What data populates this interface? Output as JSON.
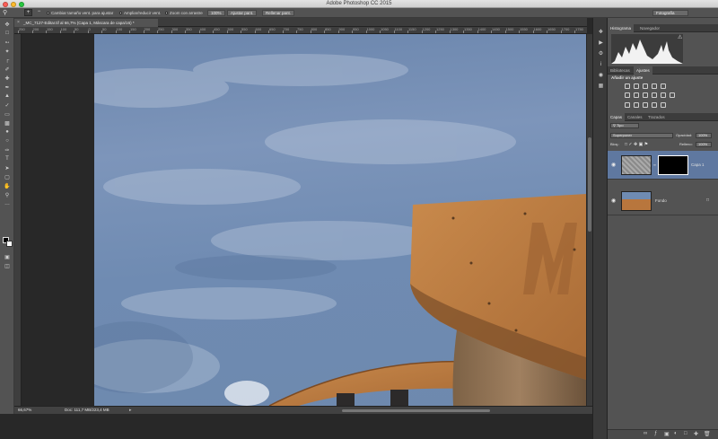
{
  "window": {
    "title": "Adobe Photoshop CC 2015"
  },
  "options_bar": {
    "resize_windows": "Cambiar tamaño vent. para ajustar",
    "zoom_all": "Ampliar/reducir vent.",
    "scrubby_zoom": "Zoom con arrastre",
    "zoom_level": "100%",
    "fit_screen": "Ajustar pant.",
    "fill_screen": "Rellenar pant.",
    "workspace": "Fotografía"
  },
  "document": {
    "tab_title": "_MC_7127-Editar.tif al 66,7% (Capa 1, Máscara de capa/16) *"
  },
  "ruler": {
    "ticks": [
      "250",
      "200",
      "150",
      "100",
      "50",
      "0",
      "50",
      "100",
      "150",
      "200",
      "250",
      "300",
      "350",
      "400",
      "450",
      "500",
      "550",
      "600",
      "650",
      "700",
      "750",
      "800",
      "850",
      "900",
      "950",
      "1000",
      "1050",
      "1100",
      "1150",
      "1200",
      "1250",
      "1300",
      "1350",
      "1400",
      "1450",
      "1500",
      "1550",
      "1600",
      "1650",
      "1700",
      "1750"
    ]
  },
  "status": {
    "zoom": "66,67%",
    "doc_info": "Doc: 111,7 MB/223,4 MB"
  },
  "panels": {
    "top_tabs": [
      "Histograma",
      "Navegador"
    ],
    "mid_tabs": [
      "Bibliotecas",
      "Ajustes"
    ],
    "add_adjustment": "Añadir un ajuste",
    "layer_tabs": [
      "Capas",
      "Canales",
      "Trazados"
    ],
    "kind_filter": "Tipo",
    "blend_mode": "Superponer",
    "opacity_label": "Opacidad:",
    "opacity_value": "100%",
    "lock_label": "Bloq.:",
    "fill_label": "Relleno:",
    "fill_value": "100%",
    "layers": [
      {
        "name": "Capa 1"
      },
      {
        "name": "Fondo"
      }
    ]
  },
  "colors": {
    "accent": "#5f78a0",
    "panel": "#535353",
    "sky": "#6f8bb2",
    "wood": "#b8763d"
  }
}
